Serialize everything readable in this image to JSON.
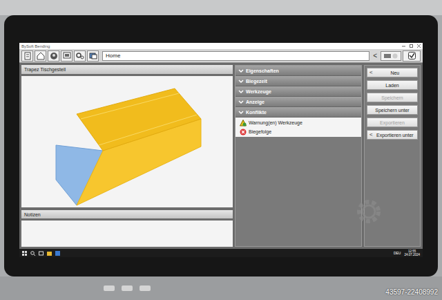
{
  "window": {
    "title": "BySoft Bending"
  },
  "toolbar": {
    "breadcrumb": "Home",
    "back": "<"
  },
  "part": {
    "title": "Trapez Tischgestell"
  },
  "notes": {
    "title": "Notizen"
  },
  "sections": [
    {
      "label": "Eigenschaften",
      "expanded": false
    },
    {
      "label": "Biegezeit",
      "expanded": false
    },
    {
      "label": "Werkzeuge",
      "expanded": false
    },
    {
      "label": "Anzeige",
      "expanded": false
    },
    {
      "label": "Konflikte",
      "expanded": true
    }
  ],
  "conflicts": [
    {
      "label": "Warnung(en) Werkzeuge",
      "kind": "warning"
    },
    {
      "label": "Biegefolge",
      "kind": "error"
    }
  ],
  "actions": [
    {
      "label": "Neu",
      "prefix": "<",
      "disabled": false
    },
    {
      "label": "Laden",
      "prefix": "",
      "disabled": false
    },
    {
      "label": "Speichern",
      "prefix": "",
      "disabled": true
    },
    {
      "label": "Speichern unter",
      "prefix": "",
      "disabled": false
    },
    {
      "label": "Exportieren",
      "prefix": "",
      "disabled": true
    },
    {
      "label": "Exportieren unter",
      "prefix": "<",
      "disabled": false
    }
  ],
  "taskbar": {
    "time": "12:55",
    "date": "24.07.2024",
    "language": "DEU"
  },
  "watermark": "43597-22408992"
}
